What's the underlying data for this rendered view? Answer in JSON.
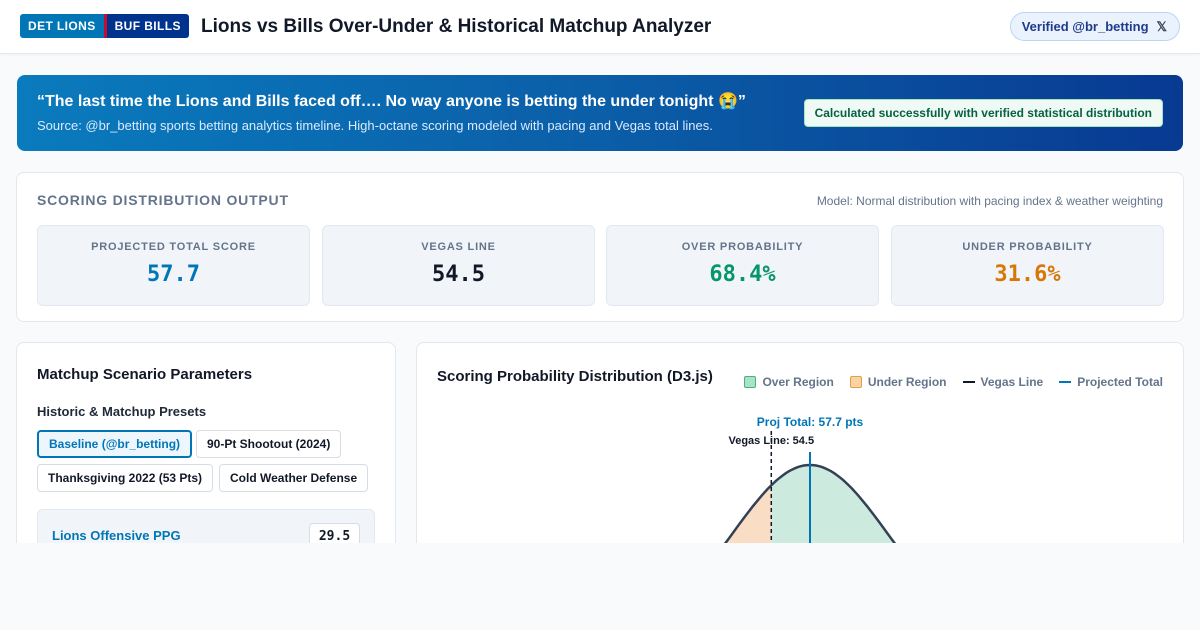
{
  "header": {
    "team_home": "DET LIONS",
    "team_away": "BUF BILLS",
    "title": "Lions vs Bills Over-Under & Historical Matchup Analyzer",
    "verified_label": "Verified @br_betting",
    "verified_icon": "x-logo-icon",
    "colors": {
      "lions": "#0076b6",
      "bills": "#00338d",
      "bills_red": "#c60c30"
    }
  },
  "hero": {
    "quote": "“The last time the Lions and Bills faced off…. No way anyone is betting the under tonight 😭”",
    "source": "Source: @br_betting sports betting analytics timeline. High-octane scoring modeled with pacing and Vegas total lines.",
    "status": "Calculated successfully with verified statistical distribution"
  },
  "output": {
    "section_label": "SCORING DISTRIBUTION OUTPUT",
    "model_note": "Model: Normal distribution with pacing index & weather weighting",
    "stats": [
      {
        "label": "PROJECTED TOTAL SCORE",
        "value": "57.7",
        "color": "#0076b6"
      },
      {
        "label": "VEGAS LINE",
        "value": "54.5",
        "color": "#111827"
      },
      {
        "label": "OVER PROBABILITY",
        "value": "68.4%",
        "color": "#059669"
      },
      {
        "label": "UNDER PROBABILITY",
        "value": "31.6%",
        "color": "#d97706"
      }
    ]
  },
  "params": {
    "title": "Matchup Scenario Parameters",
    "presets_title": "Historic & Matchup Presets",
    "presets": [
      {
        "label": "Baseline (@br_betting)",
        "active": true
      },
      {
        "label": "90-Pt Shootout (2024)",
        "active": false
      },
      {
        "label": "Thanksgiving 2022 (53 Pts)",
        "active": false
      },
      {
        "label": "Cold Weather Defense",
        "active": false
      }
    ],
    "rows": [
      {
        "label": "Lions Offensive PPG",
        "value": "29.5"
      }
    ]
  },
  "chart": {
    "title": "Scoring Probability Distribution (D3.js)",
    "legend": {
      "over": "Over Region",
      "under": "Under Region",
      "vegas": "Vegas Line",
      "projected": "Projected Total"
    },
    "annotations": {
      "projected": "Proj Total: 57.7 pts",
      "vegas": "Vegas Line: 54.5"
    },
    "colors": {
      "over": "#cdeadf",
      "under": "#f9ddc4",
      "curve": "#334155",
      "vegas": "#111827",
      "projected": "#0076b6"
    }
  },
  "chart_data": {
    "type": "area",
    "distribution": "normal",
    "mean": 57.7,
    "vegas_line": 54.5,
    "std_dev": 6.5,
    "over_probability": 68.4,
    "under_probability": 31.6,
    "legend_placement": "top-right",
    "grid": false
  }
}
